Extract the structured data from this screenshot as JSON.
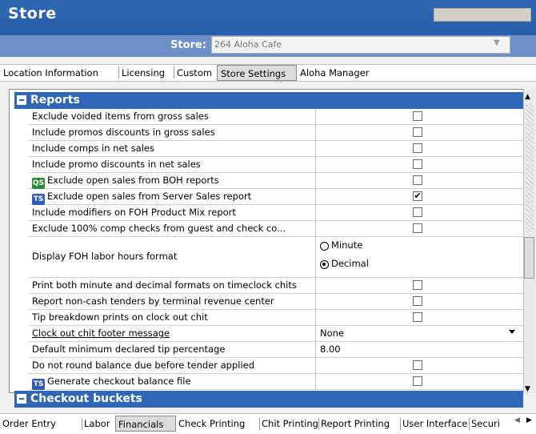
{
  "header": {
    "title": "Store",
    "store_label": "Store:",
    "store_value": "264 Aloha Cafe",
    "store_arrow": "▼"
  },
  "top_tabs": [
    {
      "label": "Location Information"
    },
    {
      "label": "Licensing"
    },
    {
      "label": "Custom"
    },
    {
      "label": "Store Settings",
      "active": true
    },
    {
      "label": "Aloha Manager"
    }
  ],
  "sections": {
    "reports": "Reports",
    "checkout_buckets": "Checkout buckets"
  },
  "rows": [
    {
      "label": "Exclude voided items from gross sales",
      "type": "checkbox",
      "checked": false
    },
    {
      "label": "Include promos discounts in gross sales",
      "type": "checkbox",
      "checked": false
    },
    {
      "label": "Include comps in net sales",
      "type": "checkbox",
      "checked": false
    },
    {
      "label": "Include promo discounts in net sales",
      "type": "checkbox",
      "checked": false
    },
    {
      "label": "Exclude open sales from BOH reports",
      "type": "checkbox",
      "checked": false,
      "badge": "QS"
    },
    {
      "label": "Exclude open sales from Server Sales report",
      "type": "checkbox",
      "checked": true,
      "badge": "TS"
    },
    {
      "label": "Include modifiers on FOH Product Mix report",
      "type": "checkbox",
      "checked": false
    },
    {
      "label": "Exclude 100% comp checks from guest and check co...",
      "type": "checkbox",
      "checked": false
    },
    {
      "label": "Display FOH labor hours format",
      "type": "radio",
      "options": [
        "Minute",
        "Decimal"
      ],
      "selected": "Decimal"
    },
    {
      "label": "Print both minute and decimal formats on timeclock chits",
      "type": "checkbox",
      "checked": false
    },
    {
      "label": "Report non-cash tenders by terminal revenue center",
      "type": "checkbox",
      "checked": false
    },
    {
      "label": "Tip breakdown prints on clock out chit",
      "type": "checkbox",
      "checked": false
    },
    {
      "label": "Clock out chit footer message",
      "type": "dropdown",
      "value": "None",
      "underline": true
    },
    {
      "label": "Default minimum declared tip percentage",
      "type": "text",
      "value": "8.00"
    },
    {
      "label": "Do not round balance due before tender applied",
      "type": "checkbox",
      "checked": false
    },
    {
      "label": "Generate checkout balance file",
      "type": "checkbox",
      "checked": false,
      "badge": "TS"
    }
  ],
  "check_mark": "✔",
  "scroll": {
    "up": "▲",
    "down": "▼"
  },
  "bottom_tabs": [
    {
      "label": "Order Entry"
    },
    {
      "label": "Labor"
    },
    {
      "label": "Financials",
      "active": true
    },
    {
      "label": "Check Printing"
    },
    {
      "label": "Chit Printing"
    },
    {
      "label": "Report Printing"
    },
    {
      "label": "User Interface"
    },
    {
      "label": "Securi"
    }
  ],
  "bottom_nav": {
    "prev": "◀",
    "next": "▶"
  },
  "colors": {
    "header_blue": "#2f68b3",
    "section_blue": "#2f66b5",
    "subheader": "#6f8fc9"
  }
}
